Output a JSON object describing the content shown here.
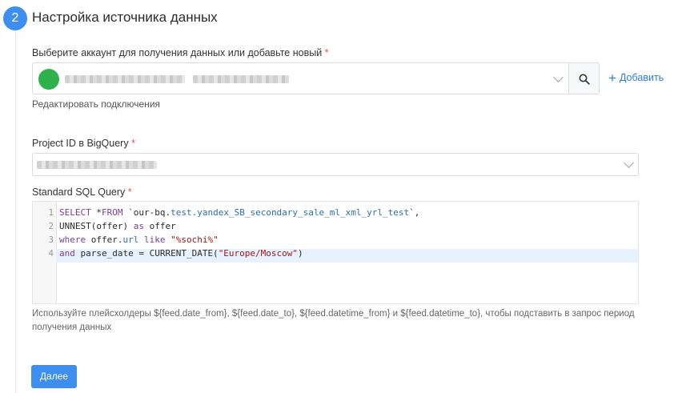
{
  "step": {
    "number": "2",
    "title": "Настройка источника данных"
  },
  "account": {
    "label": "Выберите аккаунт для получения данных или добавьте новый",
    "required_mark": "*",
    "status_color": "#2fb24c",
    "search_icon": "search-icon",
    "add_label": "Добавить",
    "add_icon": "plus-icon",
    "edit_link": "Редактировать подключения"
  },
  "project": {
    "label": "Project ID в BigQuery",
    "required_mark": "*"
  },
  "sql": {
    "label": "Standard SQL Query",
    "required_mark": "*",
    "line_numbers": [
      "1",
      "2",
      "3",
      "4"
    ],
    "lines": [
      "SELECT *FROM `our-bq.test.yandex_SB_secondary_sale_ml_xml_yrl_test`,",
      "UNNEST(offer) as offer",
      "where offer.url like \"%sochi%\"",
      "and parse_date = CURRENT_DATE(\"Europe/Moscow\")"
    ],
    "active_line": 4
  },
  "hint": "Используйте плейсхолдеры ${feed.date_from}, ${feed.date_to}, ${feed.datetime_from} и ${feed.datetime_to}, чтобы подставить в запрос период получения данных",
  "next_button": "Далее",
  "colors": {
    "accent": "#3d8eef",
    "required": "#e35353",
    "link": "#2c7be5"
  }
}
